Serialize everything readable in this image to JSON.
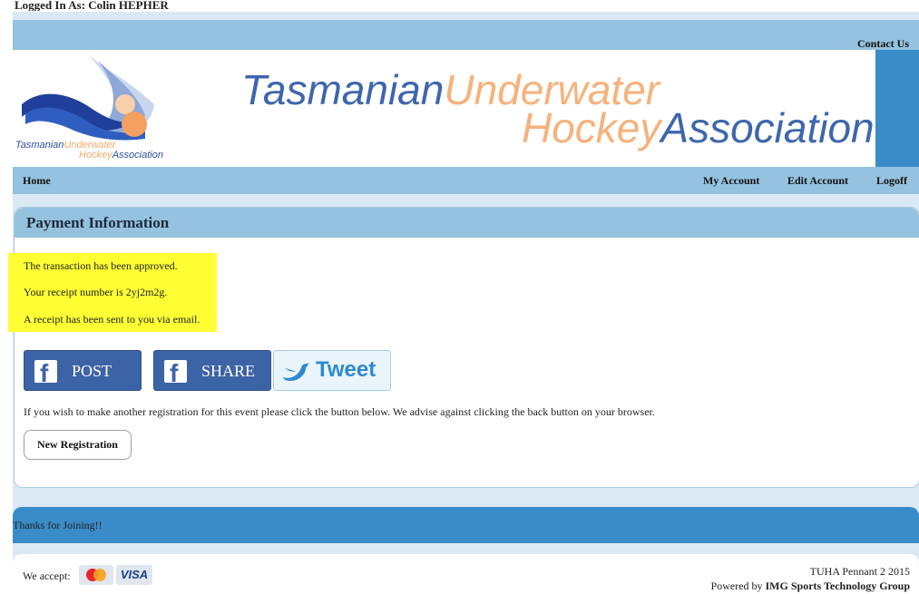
{
  "login": {
    "text": "Logged In As: Colin HEPHER"
  },
  "header": {
    "contact_label": "Contact Us",
    "logo_text": {
      "part1": "Tasmanian",
      "part2": "Underwater",
      "part3": "Hockey",
      "part4": "Association"
    },
    "title": {
      "word1": "Tasmanian",
      "word2": "Underwater",
      "word3": "Hockey",
      "word4": "Association"
    }
  },
  "nav": {
    "home": "Home",
    "my_account": "My Account",
    "edit_account": "Edit Account",
    "logoff": "Logoff"
  },
  "panel": {
    "title": "Payment Information",
    "messages": [
      "The transaction has been approved.",
      "Your receipt number is 2yj2m2g.",
      "A receipt has been sent to you via email."
    ],
    "social": {
      "post_label": "POST",
      "share_label": "SHARE",
      "tweet_label": "Tweet",
      "fb_glyph": "f"
    },
    "advice": "If you wish to make another registration for this event please click the button below. We advise against clicking the back button on your browser.",
    "new_registration_label": "New Registration"
  },
  "thanks": "Thanks for Joining!!",
  "footer": {
    "we_accept": "We accept:",
    "visa_label": "VISA",
    "event_name": "TUHA Pennant 2 2015",
    "powered_prefix": "Powered by",
    "powered_company": "IMG Sports Technology Group"
  },
  "colors": {
    "bar_light": "#95c2de",
    "bar_dark": "#3a8cc8",
    "highlight": "#ffff33",
    "facebook": "#3d63a7",
    "twitter": "#2d8ad1"
  }
}
